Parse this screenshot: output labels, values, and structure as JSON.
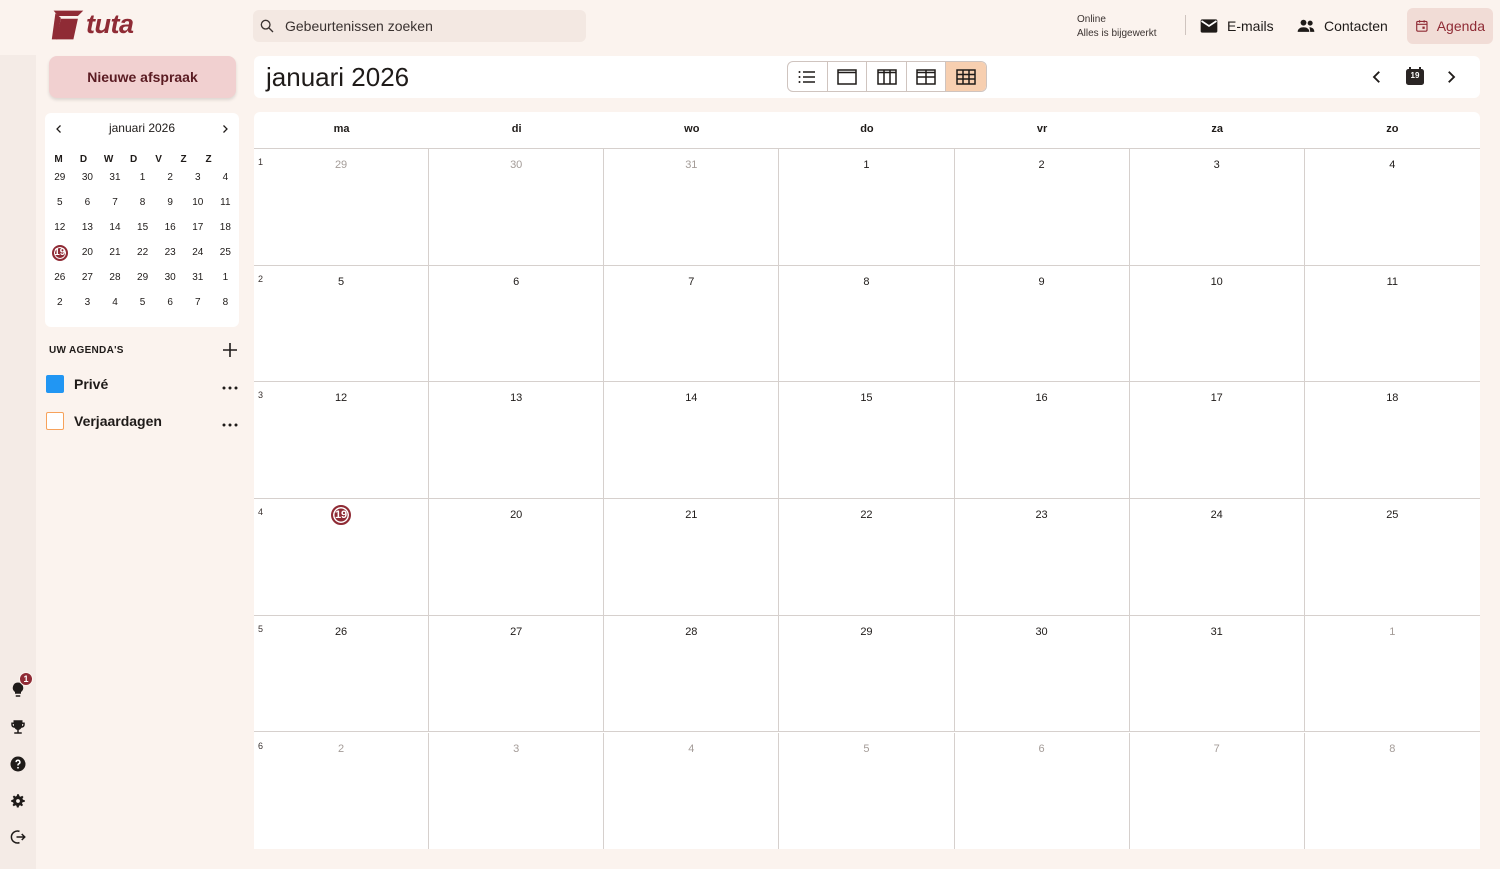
{
  "app": {
    "logo_text": "tuta",
    "brand_color": "#8f2b35"
  },
  "search": {
    "placeholder": "Gebeurtenissen zoeken"
  },
  "status": {
    "line1": "Online",
    "line2": "Alles is bijgewerkt"
  },
  "nav": {
    "mail": "E-mails",
    "contacts": "Contacten",
    "agenda": "Agenda"
  },
  "sidebar": {
    "new_event": "Nieuwe afspraak",
    "mini_calendar": {
      "title": "januari 2026",
      "weekdays": [
        "M",
        "D",
        "W",
        "D",
        "V",
        "Z",
        "Z"
      ],
      "weeks": [
        [
          "29",
          "30",
          "31",
          "1",
          "2",
          "3",
          "4"
        ],
        [
          "5",
          "6",
          "7",
          "8",
          "9",
          "10",
          "11"
        ],
        [
          "12",
          "13",
          "14",
          "15",
          "16",
          "17",
          "18"
        ],
        [
          "19",
          "20",
          "21",
          "22",
          "23",
          "24",
          "25"
        ],
        [
          "26",
          "27",
          "28",
          "29",
          "30",
          "31",
          "1"
        ],
        [
          "2",
          "3",
          "4",
          "5",
          "6",
          "7",
          "8"
        ]
      ],
      "today": "19"
    },
    "agendas_title": "UW AGENDA'S",
    "agendas": [
      {
        "label": "Privé",
        "color": "#2196f3"
      },
      {
        "label": "Verjaardagen",
        "color": "#f7a25b"
      }
    ],
    "notification_count": "1"
  },
  "toolbar": {
    "title": "januari 2026",
    "today_badge": "19"
  },
  "month": {
    "weekdays": [
      "ma",
      "di",
      "wo",
      "do",
      "vr",
      "za",
      "zo"
    ],
    "weeks": [
      {
        "number": "1",
        "days": [
          "29",
          "30",
          "31",
          "1",
          "2",
          "3",
          "4"
        ],
        "muted": [
          true,
          true,
          true,
          false,
          false,
          false,
          false
        ]
      },
      {
        "number": "2",
        "days": [
          "5",
          "6",
          "7",
          "8",
          "9",
          "10",
          "11"
        ],
        "muted": [
          false,
          false,
          false,
          false,
          false,
          false,
          false
        ]
      },
      {
        "number": "3",
        "days": [
          "12",
          "13",
          "14",
          "15",
          "16",
          "17",
          "18"
        ],
        "muted": [
          false,
          false,
          false,
          false,
          false,
          false,
          false
        ]
      },
      {
        "number": "4",
        "days": [
          "19",
          "20",
          "21",
          "22",
          "23",
          "24",
          "25"
        ],
        "muted": [
          false,
          false,
          false,
          false,
          false,
          false,
          false
        ]
      },
      {
        "number": "5",
        "days": [
          "26",
          "27",
          "28",
          "29",
          "30",
          "31",
          "1"
        ],
        "muted": [
          false,
          false,
          false,
          false,
          false,
          false,
          true
        ]
      },
      {
        "number": "6",
        "days": [
          "2",
          "3",
          "4",
          "5",
          "6",
          "7",
          "8"
        ],
        "muted": [
          true,
          true,
          true,
          true,
          true,
          true,
          true
        ]
      }
    ],
    "today": "19"
  }
}
